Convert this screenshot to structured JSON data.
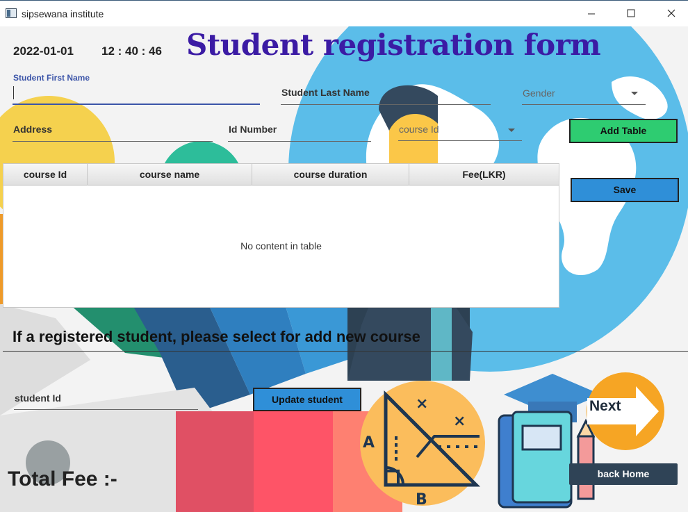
{
  "window": {
    "title": "sipsewana institute",
    "minimize": "—",
    "maximize": "☐",
    "close": "✕"
  },
  "header": {
    "date": "2022-01-01",
    "time": "12 : 40 : 46",
    "title": "Student registration form"
  },
  "form": {
    "first_name_label": "Student First Name",
    "first_name_value": "",
    "last_name_label": "Student Last Name",
    "gender_label": "Gender",
    "address_label": "Address",
    "id_number_label": "Id Number",
    "course_id_label": "course Id"
  },
  "buttons": {
    "add_table": "Add Table",
    "save": "Save",
    "update_student": "Update student",
    "back_home": "back Home",
    "next": "Next"
  },
  "table": {
    "columns": [
      "course Id",
      "course name",
      "course duration",
      "Fee(LKR)"
    ],
    "rows": [],
    "empty_message": "No content in table"
  },
  "registered_prompt": "If a registered student, please select for add new course",
  "student_id_label": "student Id",
  "total_fee_label": "Total Fee :-",
  "colors": {
    "title": "#3b1ba4",
    "add_button": "#2ecc71",
    "save_button": "#2f8fd8",
    "active_field": "#3b54a8",
    "back_home": "#2f4356",
    "globe": "#5bbde9",
    "next_circle": "#f6a524"
  },
  "icons": [
    "app-icon",
    "minimize-icon",
    "maximize-icon",
    "close-icon",
    "chevron-down-icon",
    "next-arrow-icon",
    "geometry-icon",
    "book-graduation-icon",
    "globe-illustration"
  ]
}
